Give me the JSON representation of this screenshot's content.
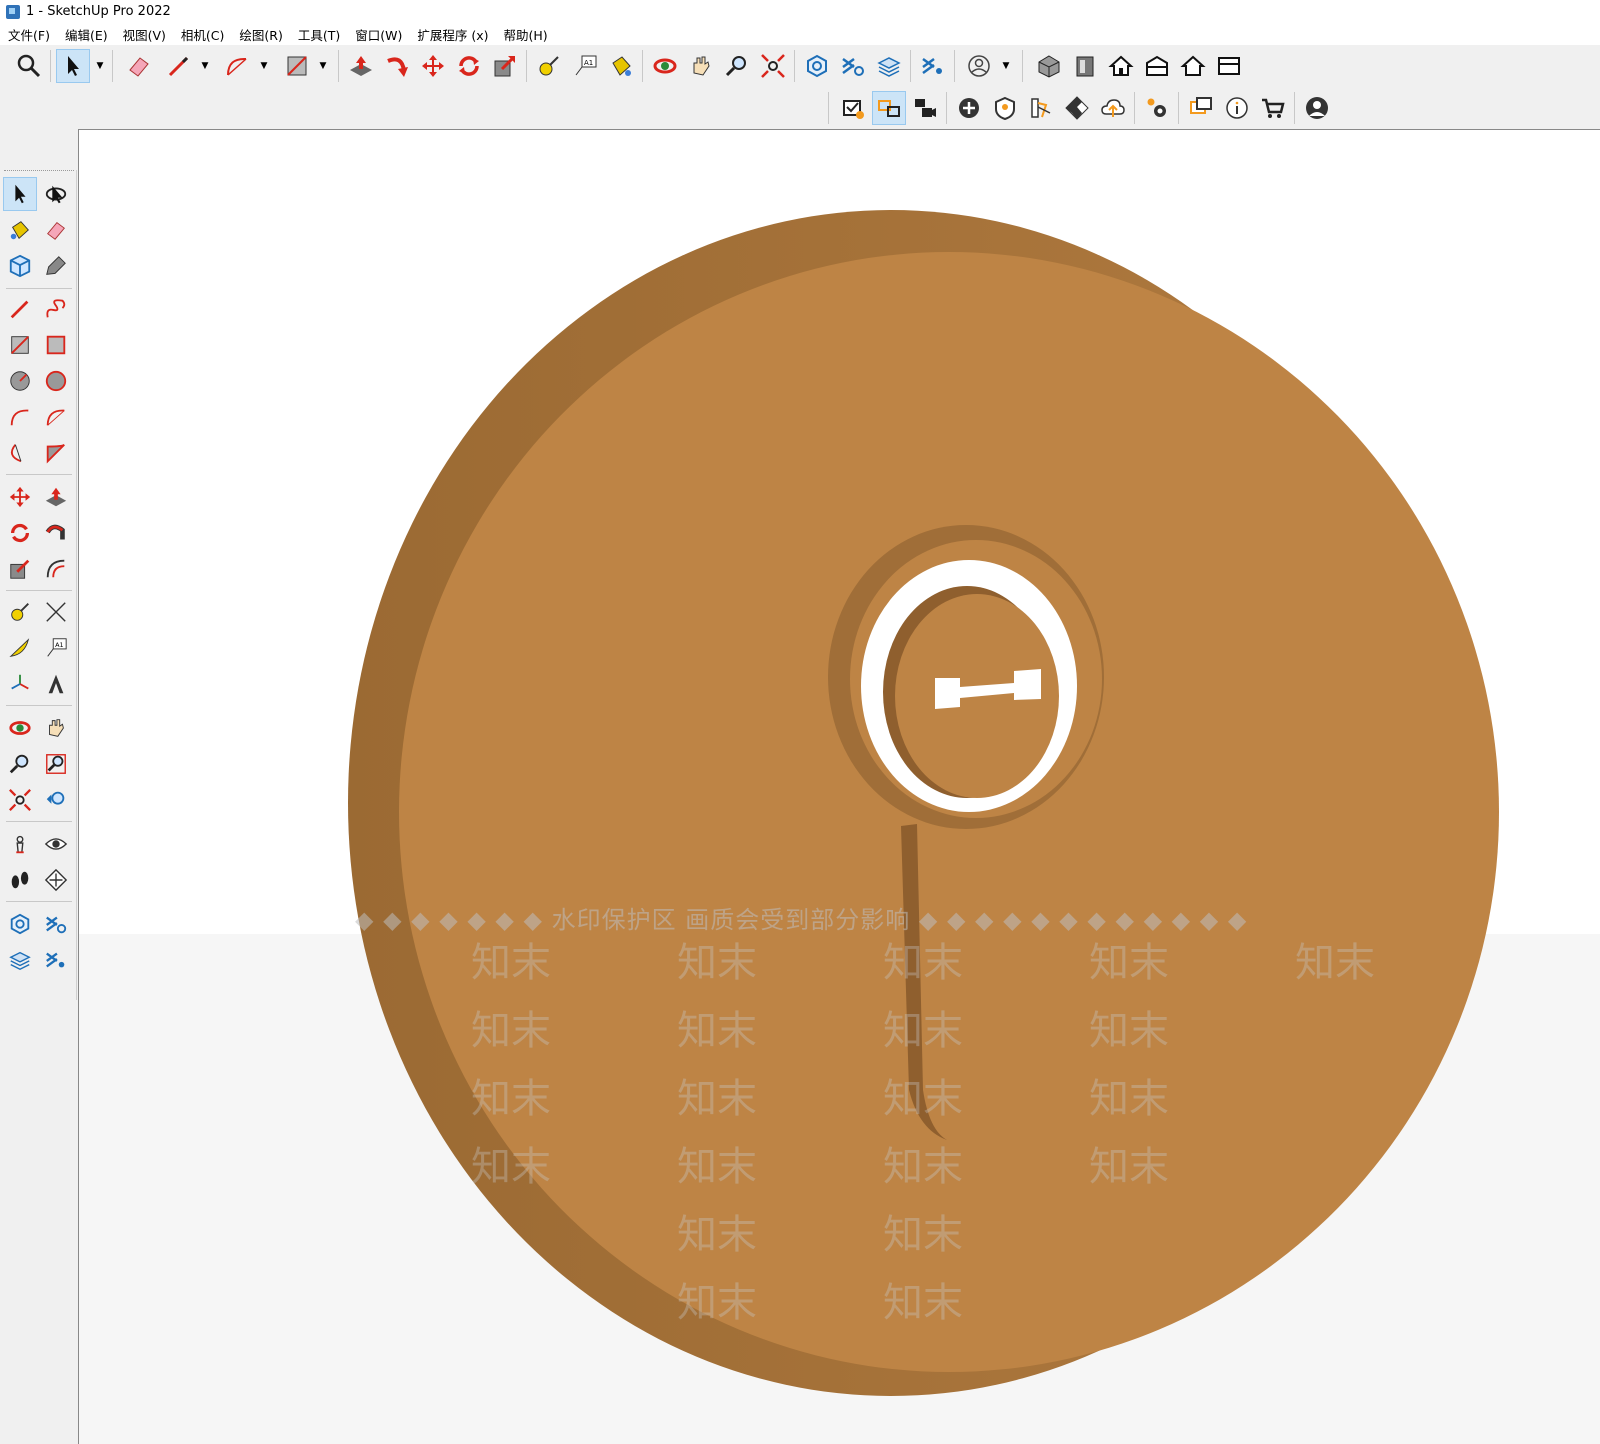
{
  "window": {
    "title": "1 - SketchUp Pro 2022"
  },
  "menu": [
    "文件(F)",
    "编辑(E)",
    "视图(V)",
    "相机(C)",
    "绘图(R)",
    "工具(T)",
    "窗口(W)",
    "扩展程序 (x)",
    "帮助(H)"
  ],
  "toolbar_top": [
    "zoom-icon",
    "select-icon",
    "eraser-icon",
    "pencil-icon",
    "arc-icon",
    "rectangle-icon",
    "push-pull-icon",
    "follow-me-icon",
    "move-icon",
    "rotate-icon",
    "scale-icon",
    "tape-measure-icon",
    "text-icon",
    "paint-bucket-icon",
    "orbit-icon",
    "pan-icon",
    "zoom-icon",
    "zoom-extents-icon",
    "warehouse-icon",
    "extension-warehouse-icon",
    "layout-icon",
    "extension-manager-icon",
    "profile-icon",
    "iso-view-icon",
    "front-view-icon",
    "home-view-icon",
    "top-view-icon",
    "house-icon",
    "back-view-icon"
  ],
  "toolbar_second": [
    "license-icon",
    "switch-icon",
    "video-icon",
    "add-icon",
    "shield-icon",
    "style-icon",
    "checker-icon",
    "cloud-upload-icon",
    "settings-icon",
    "comment-icon",
    "info-icon",
    "cart-icon",
    "account-icon"
  ],
  "left_toolbar": [
    "select-icon",
    "orbit-icon",
    "paint-bucket-icon",
    "eraser-icon",
    "component-icon",
    "tag-icon",
    "pencil-icon",
    "freehand-icon",
    "rectangle-icon",
    "rotated-rectangle-icon",
    "circle-icon",
    "polygon-icon",
    "arc-icon",
    "two-point-arc-icon",
    "three-point-arc-icon",
    "pie-icon",
    "move-icon",
    "push-pull-icon",
    "rotate-icon",
    "follow-me-icon",
    "scale-icon",
    "offset-icon",
    "tape-measure-icon",
    "dimension-icon",
    "protractor-icon",
    "text-icon",
    "axes-icon",
    "3d-text-icon",
    "orbit-icon",
    "pan-icon",
    "zoom-icon",
    "zoom-window-icon",
    "zoom-extents-icon",
    "previous-view-icon",
    "position-camera-icon",
    "look-around-icon",
    "walk-icon",
    "section-plane-icon",
    "warehouse-icon",
    "extension-warehouse-icon",
    "layout-icon",
    "extension-manager-icon"
  ],
  "watermark": {
    "notice": "水印保护区   画质会受到部分影响",
    "brand": "知末"
  },
  "model": {
    "color": "#c08545",
    "dark_color": "#9a6a35"
  }
}
